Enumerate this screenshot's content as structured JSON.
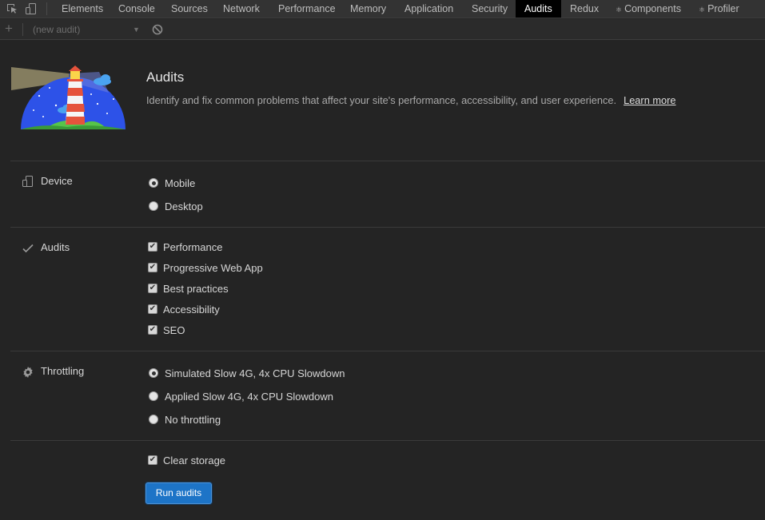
{
  "tabs": [
    {
      "label": "Elements"
    },
    {
      "label": "Console"
    },
    {
      "label": "Sources"
    },
    {
      "label": "Network"
    },
    {
      "label": "Performance"
    },
    {
      "label": "Memory"
    },
    {
      "label": "Application"
    },
    {
      "label": "Security"
    },
    {
      "label": "Audits",
      "active": true
    },
    {
      "label": "Redux"
    },
    {
      "label": "Components",
      "icon": "react-gear-icon"
    },
    {
      "label": "Profiler",
      "icon": "react-gear-icon"
    }
  ],
  "subbar": {
    "add_icon": "plus-icon",
    "select_value": "(new audit)",
    "clear_icon": "block-icon"
  },
  "header": {
    "title": "Audits",
    "description": "Identify and fix common problems that affect your site's performance, accessibility, and user experience.",
    "learn_more": "Learn more"
  },
  "device": {
    "label": "Device",
    "icon": "device-icon",
    "options": [
      {
        "label": "Mobile",
        "checked": true
      },
      {
        "label": "Desktop",
        "checked": false
      }
    ]
  },
  "audits": {
    "label": "Audits",
    "icon": "checkmark-icon",
    "options": [
      {
        "label": "Performance",
        "checked": true
      },
      {
        "label": "Progressive Web App",
        "checked": true
      },
      {
        "label": "Best practices",
        "checked": true
      },
      {
        "label": "Accessibility",
        "checked": true
      },
      {
        "label": "SEO",
        "checked": true
      }
    ]
  },
  "throttling": {
    "label": "Throttling",
    "icon": "gear-icon",
    "options": [
      {
        "label": "Simulated Slow 4G, 4x CPU Slowdown",
        "checked": true
      },
      {
        "label": "Applied Slow 4G, 4x CPU Slowdown",
        "checked": false
      },
      {
        "label": "No throttling",
        "checked": false
      }
    ]
  },
  "clear_storage": {
    "label": "Clear storage",
    "checked": true
  },
  "run_button": "Run audits",
  "colors": {
    "background": "#242424",
    "tabbar": "#333333",
    "active_tab": "#000000",
    "button": "#1d74c7"
  }
}
